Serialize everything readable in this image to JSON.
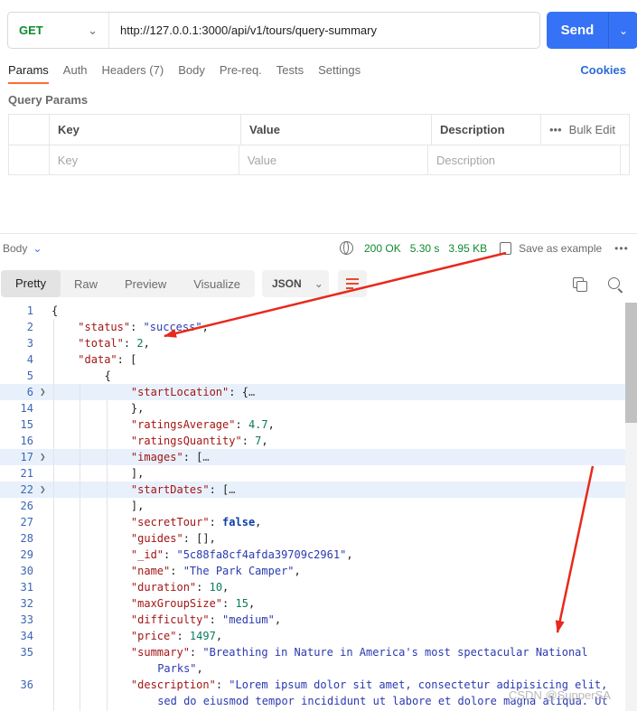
{
  "request": {
    "method": "GET",
    "url": "http://127.0.0.1:3000/api/v1/tours/query-summary",
    "send_label": "Send"
  },
  "request_tabs": [
    "Params",
    "Auth",
    "Headers (7)",
    "Body",
    "Pre-req.",
    "Tests",
    "Settings"
  ],
  "cookies_label": "Cookies",
  "query_params": {
    "title": "Query Params",
    "headers": [
      "Key",
      "Value",
      "Description"
    ],
    "bulk_edit": "Bulk Edit",
    "placeholders": [
      "Key",
      "Value",
      "Description"
    ]
  },
  "response": {
    "body_label": "Body",
    "status": "200 OK",
    "time": "5.30 s",
    "size": "3.95 KB",
    "save_label": "Save as example",
    "tabs": [
      "Pretty",
      "Raw",
      "Preview",
      "Visualize"
    ],
    "format": "JSON"
  },
  "code_lines": [
    {
      "n": "1",
      "indent": 0,
      "fold": false,
      "hl": false,
      "parts": [
        [
          "p",
          "{"
        ]
      ]
    },
    {
      "n": "2",
      "indent": 1,
      "fold": false,
      "hl": false,
      "parts": [
        [
          "k",
          "\"status\""
        ],
        [
          "p",
          ": "
        ],
        [
          "s",
          "\"success\""
        ],
        [
          "p",
          ","
        ]
      ]
    },
    {
      "n": "3",
      "indent": 1,
      "fold": false,
      "hl": false,
      "parts": [
        [
          "k",
          "\"total\""
        ],
        [
          "p",
          ": "
        ],
        [
          "n",
          "2"
        ],
        [
          "p",
          ","
        ]
      ]
    },
    {
      "n": "4",
      "indent": 1,
      "fold": false,
      "hl": false,
      "parts": [
        [
          "k",
          "\"data\""
        ],
        [
          "p",
          ": ["
        ]
      ]
    },
    {
      "n": "5",
      "indent": 2,
      "fold": false,
      "hl": false,
      "parts": [
        [
          "p",
          "{"
        ]
      ]
    },
    {
      "n": "6",
      "indent": 3,
      "fold": true,
      "hl": true,
      "parts": [
        [
          "k",
          "\"startLocation\""
        ],
        [
          "p",
          ": {"
        ],
        [
          "e",
          "…"
        ]
      ]
    },
    {
      "n": "14",
      "indent": 3,
      "fold": false,
      "hl": false,
      "parts": [
        [
          "p",
          "},"
        ]
      ]
    },
    {
      "n": "15",
      "indent": 3,
      "fold": false,
      "hl": false,
      "parts": [
        [
          "k",
          "\"ratingsAverage\""
        ],
        [
          "p",
          ": "
        ],
        [
          "n",
          "4.7"
        ],
        [
          "p",
          ","
        ]
      ]
    },
    {
      "n": "16",
      "indent": 3,
      "fold": false,
      "hl": false,
      "parts": [
        [
          "k",
          "\"ratingsQuantity\""
        ],
        [
          "p",
          ": "
        ],
        [
          "n",
          "7"
        ],
        [
          "p",
          ","
        ]
      ]
    },
    {
      "n": "17",
      "indent": 3,
      "fold": true,
      "hl": true,
      "parts": [
        [
          "k",
          "\"images\""
        ],
        [
          "p",
          ": ["
        ],
        [
          "e",
          "…"
        ]
      ]
    },
    {
      "n": "21",
      "indent": 3,
      "fold": false,
      "hl": false,
      "parts": [
        [
          "p",
          "],"
        ]
      ]
    },
    {
      "n": "22",
      "indent": 3,
      "fold": true,
      "hl": true,
      "parts": [
        [
          "k",
          "\"startDates\""
        ],
        [
          "p",
          ": ["
        ],
        [
          "e",
          "…"
        ]
      ]
    },
    {
      "n": "26",
      "indent": 3,
      "fold": false,
      "hl": false,
      "parts": [
        [
          "p",
          "],"
        ]
      ]
    },
    {
      "n": "27",
      "indent": 3,
      "fold": false,
      "hl": false,
      "parts": [
        [
          "k",
          "\"secretTour\""
        ],
        [
          "p",
          ": "
        ],
        [
          "b",
          "false"
        ],
        [
          "p",
          ","
        ]
      ]
    },
    {
      "n": "28",
      "indent": 3,
      "fold": false,
      "hl": false,
      "parts": [
        [
          "k",
          "\"guides\""
        ],
        [
          "p",
          ": [],"
        ]
      ]
    },
    {
      "n": "29",
      "indent": 3,
      "fold": false,
      "hl": false,
      "parts": [
        [
          "k",
          "\"_id\""
        ],
        [
          "p",
          ": "
        ],
        [
          "s",
          "\"5c88fa8cf4afda39709c2961\""
        ],
        [
          "p",
          ","
        ]
      ]
    },
    {
      "n": "30",
      "indent": 3,
      "fold": false,
      "hl": false,
      "parts": [
        [
          "k",
          "\"name\""
        ],
        [
          "p",
          ": "
        ],
        [
          "s",
          "\"The Park Camper\""
        ],
        [
          "p",
          ","
        ]
      ]
    },
    {
      "n": "31",
      "indent": 3,
      "fold": false,
      "hl": false,
      "parts": [
        [
          "k",
          "\"duration\""
        ],
        [
          "p",
          ": "
        ],
        [
          "n",
          "10"
        ],
        [
          "p",
          ","
        ]
      ]
    },
    {
      "n": "32",
      "indent": 3,
      "fold": false,
      "hl": false,
      "parts": [
        [
          "k",
          "\"maxGroupSize\""
        ],
        [
          "p",
          ": "
        ],
        [
          "n",
          "15"
        ],
        [
          "p",
          ","
        ]
      ]
    },
    {
      "n": "33",
      "indent": 3,
      "fold": false,
      "hl": false,
      "parts": [
        [
          "k",
          "\"difficulty\""
        ],
        [
          "p",
          ": "
        ],
        [
          "s",
          "\"medium\""
        ],
        [
          "p",
          ","
        ]
      ]
    },
    {
      "n": "34",
      "indent": 3,
      "fold": false,
      "hl": false,
      "parts": [
        [
          "k",
          "\"price\""
        ],
        [
          "p",
          ": "
        ],
        [
          "n",
          "1497"
        ],
        [
          "p",
          ","
        ]
      ]
    },
    {
      "n": "35",
      "indent": 3,
      "fold": false,
      "hl": false,
      "parts": [
        [
          "k",
          "\"summary\""
        ],
        [
          "p",
          ": "
        ],
        [
          "s",
          "\"Breathing in Nature in America's most spectacular National"
        ]
      ]
    },
    {
      "n": "",
      "indent": 4,
      "fold": false,
      "hl": false,
      "parts": [
        [
          "s",
          "Parks\""
        ],
        [
          "p",
          ","
        ]
      ]
    },
    {
      "n": "36",
      "indent": 3,
      "fold": false,
      "hl": false,
      "parts": [
        [
          "k",
          "\"description\""
        ],
        [
          "p",
          ": "
        ],
        [
          "s",
          "\"Lorem ipsum dolor sit amet, consectetur adipisicing elit,"
        ]
      ]
    },
    {
      "n": "",
      "indent": 4,
      "fold": false,
      "hl": false,
      "parts": [
        [
          "s",
          "sed do eiusmod tempor incididunt ut labore et dolore magna aliqua. Ut"
        ]
      ]
    }
  ],
  "watermark": "CSDN @SupperSA",
  "colors": {
    "accent": "#3672f5",
    "ok": "#0f8a2f",
    "arrow": "#e8291c"
  }
}
